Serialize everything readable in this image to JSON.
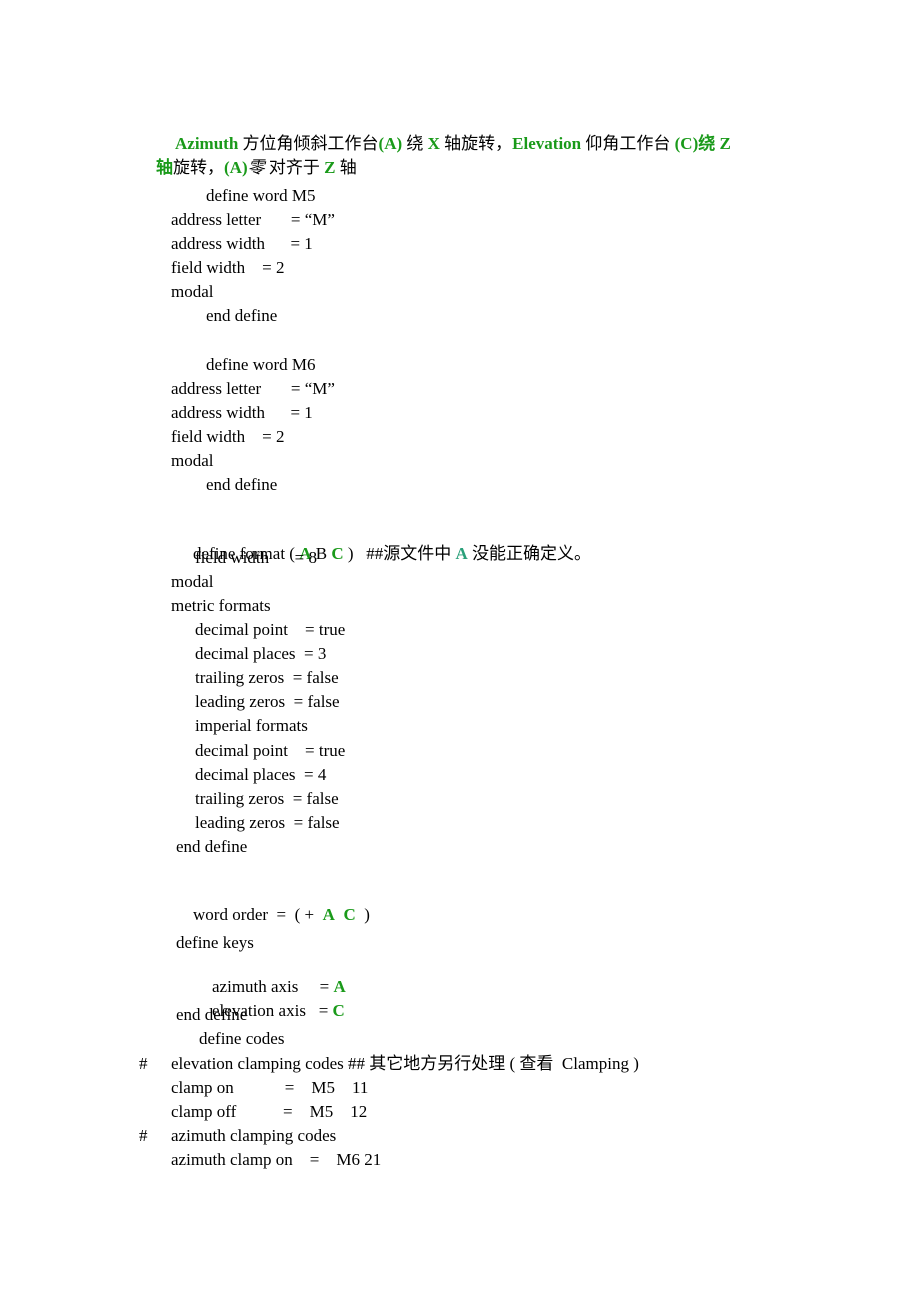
{
  "heading": {
    "line1": [
      {
        "text": "Azimuth",
        "style": "green"
      },
      {
        "text": " 方位角倾斜工作台",
        "style": "plain"
      },
      {
        "text": "(A)",
        "style": "green"
      },
      {
        "text": " 绕 ",
        "style": "plain"
      },
      {
        "text": "X",
        "style": "green"
      },
      {
        "text": " 轴旋转，",
        "style": "plain"
      },
      {
        "text": "Elevation",
        "style": "green"
      },
      {
        "text": " 仰角工作台 ",
        "style": "plain"
      },
      {
        "text": "(C)绕 Z",
        "style": "green"
      }
    ],
    "line2": [
      {
        "text": "轴",
        "style": "green"
      },
      {
        "text": "旋转，",
        "style": "plain"
      },
      {
        "text": "(A)",
        "style": "green"
      },
      {
        "text": "零",
        "style": "plain"
      },
      {
        "text": " 对齐于 ",
        "style": "plain"
      },
      {
        "text": "Z",
        "style": "green"
      },
      {
        "text": " 轴",
        "style": "plain"
      }
    ]
  },
  "code": {
    "m5": {
      "define": "define word M5",
      "address_letter": "address letter       = “M”",
      "address_width": "address width      = 1",
      "field_width": "field width    = 2",
      "modal": "modal",
      "end": "end define"
    },
    "m6": {
      "define": "define word M6",
      "address_letter": "address letter       = “M”",
      "address_width": "address width      = 1",
      "field_width": "field width    = 2",
      "modal": "modal",
      "end": "end define"
    },
    "format": {
      "define_pre": "define format ( ",
      "a": "A",
      "b": " B ",
      "c": "C",
      "define_post": " )   ##源文件中 ",
      "a2": "A",
      "comment_post": " 没能正确定义。",
      "field_width": "field width      = 8",
      "modal": "modal",
      "metric": "metric formats",
      "m_decimal_point": "decimal point    = true",
      "m_decimal_places": "decimal places  = 3",
      "m_trailing": "trailing zeros  = false",
      "m_leading": "leading zeros  = false",
      "imperial": "imperial formats",
      "i_decimal_point": "decimal point    = true",
      "i_decimal_places": "decimal places  = 4",
      "i_trailing": "trailing zeros  = false",
      "i_leading": "leading zeros  = false",
      "end": "end define"
    },
    "word_order": {
      "pre": "word order  =  ( +  ",
      "a": "A",
      "c": "C",
      "post": "  )"
    },
    "keys": {
      "define": "define keys",
      "azimuth_label": "azimuth axis     = ",
      "azimuth_value": "A",
      "elevation_label": "elevation axis   = ",
      "elevation_value": "C",
      "end": "end define"
    },
    "codes": {
      "define": "define codes",
      "hash1": "#",
      "elev_comment": "elevation clamping codes ## 其它地方另行处理 ( 查看  Clamping )",
      "clamp_on": "clamp on            =    M5    11",
      "clamp_off": "clamp off           =    M5    12",
      "hash2": "#",
      "azi_comment": "azimuth clamping codes",
      "azi_clamp_on": "azimuth clamp on    =    M6 21"
    }
  }
}
